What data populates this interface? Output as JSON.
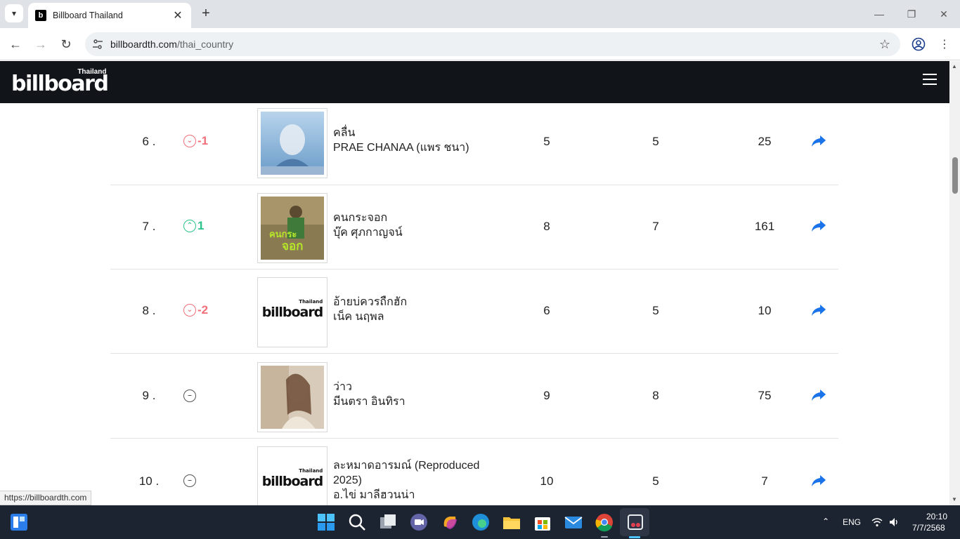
{
  "browser": {
    "tab_title": "Billboard Thailand",
    "url_domain": "billboardth.com",
    "url_path": "/thai_country",
    "status_url": "https://billboardth.com"
  },
  "site": {
    "logo_text": "billboard",
    "logo_sub": "Thailand"
  },
  "chart_rows": [
    {
      "rank": "6 .",
      "move": "-1",
      "dir": "down",
      "title": "คลื่น",
      "artist": "PRAE CHANAA (แพร ชนา)",
      "last_week": "5",
      "peak": "5",
      "weeks": "25"
    },
    {
      "rank": "7 .",
      "move": "1",
      "dir": "up",
      "title": "คนกระจอก",
      "artist": "บุ๊ค ศุภกาญจน์",
      "last_week": "8",
      "peak": "7",
      "weeks": "161"
    },
    {
      "rank": "8 .",
      "move": "-2",
      "dir": "down",
      "title": "อ้ายบ่ควรถืกฮัก",
      "artist": "เน็ค นฤพล",
      "last_week": "6",
      "peak": "5",
      "weeks": "10"
    },
    {
      "rank": "9 .",
      "move": "",
      "dir": "same",
      "title": "ว่าว",
      "artist": "มีนตรา อินทิรา",
      "last_week": "9",
      "peak": "8",
      "weeks": "75"
    },
    {
      "rank": "10 .",
      "move": "",
      "dir": "same",
      "title": "ละหมาดอารมณ์ (Reproduced 2025)",
      "artist": "อ.ไข่ มาลีฮวนน่า",
      "last_week": "10",
      "peak": "5",
      "weeks": "7"
    }
  ],
  "taskbar": {
    "language": "ENG",
    "time": "20:10",
    "date": "7/7/2568"
  },
  "colors": {
    "header_bg": "#111418",
    "down": "#f0707a",
    "up": "#2ac48a",
    "share": "#1a73e8"
  }
}
